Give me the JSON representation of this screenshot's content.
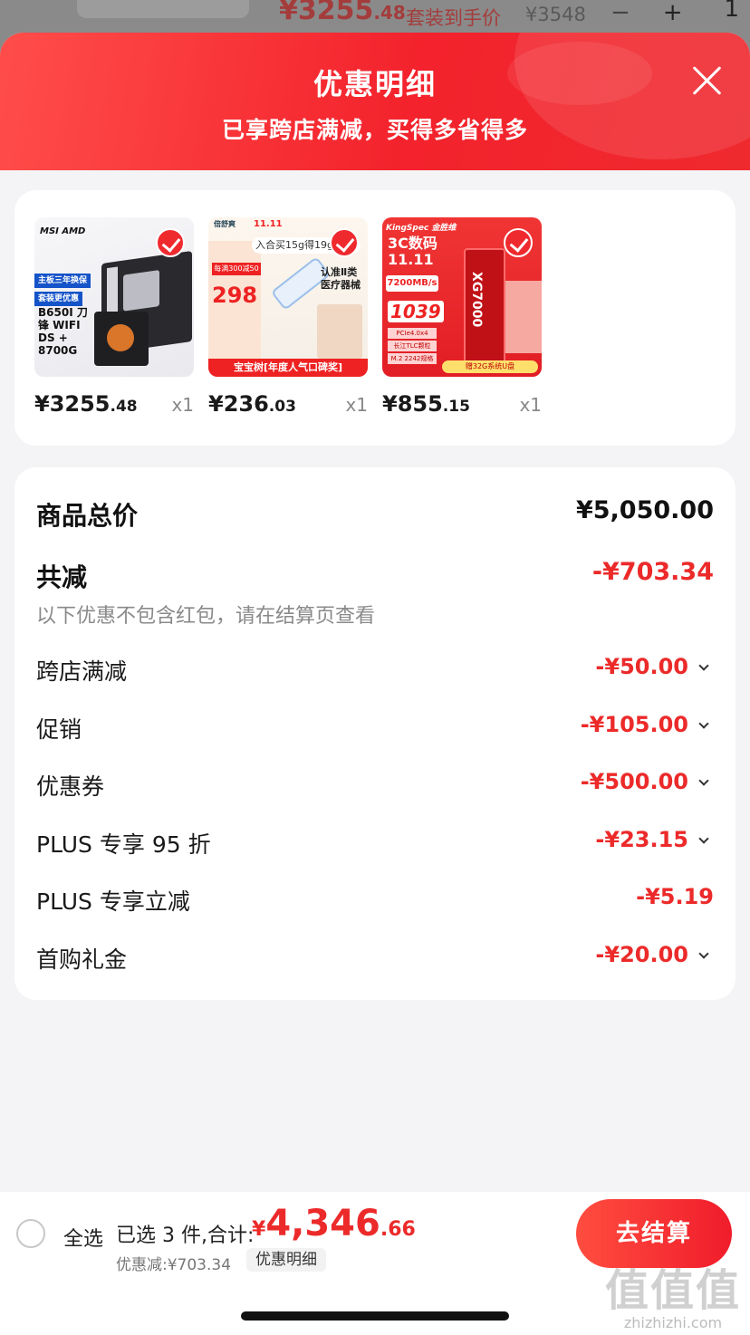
{
  "behind": {
    "price_int": "¥3255",
    "price_dec": ".48",
    "tag": "套装到手价",
    "orig": "¥3548",
    "minus": "−",
    "qty": "1",
    "plus": "+"
  },
  "header": {
    "title": "优惠明细",
    "subtitle": "已享跨店满减，买得多省得多"
  },
  "products": [
    {
      "price_int": "¥3255",
      "price_dec": ".48",
      "qty": "x1",
      "art": {
        "brand": "MSI AMD",
        "tag1": "主板三年换保",
        "tag2": "套装更优惠",
        "model": "B650I 刀锋 WIFI DS + 8700G"
      }
    },
    {
      "price_int": "¥236",
      "price_dec": ".03",
      "qty": "x1",
      "art": {
        "logo": "倍舒爽",
        "date": "11.11",
        "bubble": "入合买15g得19g",
        "label": "每满300减50",
        "big": "298",
        "side": "认准Ⅱ类 医疗器械",
        "bottom": "宝宝树[年度人气口碑奖]"
      }
    },
    {
      "price_int": "¥855",
      "price_dec": ".15",
      "qty": "x1",
      "art": {
        "brand": "KingSpec 金胜维",
        "title": "3C数码 11.11",
        "speed": "7200MB/s",
        "price": "1039",
        "info1": "PCIe4.0x4",
        "info2": "长江TLC颗粒",
        "info3": "M.2 2242规格",
        "ssd": "XG7000",
        "gift": "赠32G系统U盘"
      }
    }
  ],
  "summary": {
    "total_label": "商品总价",
    "total_value": "¥5,050.00",
    "reduce_label": "共减",
    "reduce_value": "-¥703.34",
    "note": "以下优惠不包含红包，请在结算页查看",
    "items": [
      {
        "label": "跨店满减",
        "value": "-¥50.00"
      },
      {
        "label": "促销",
        "value": "-¥105.00"
      },
      {
        "label": "优惠券",
        "value": "-¥500.00"
      },
      {
        "label": "PLUS 专享 95 折",
        "value": "-¥23.15"
      },
      {
        "label": "PLUS 专享立减",
        "value": "-¥5.19"
      },
      {
        "label": "首购礼金",
        "value": "-¥20.00"
      }
    ]
  },
  "footer": {
    "select_all": "全选",
    "selected": "已选 3 件,合计:",
    "total_yen": "¥",
    "total_int": "4,346",
    "total_dec": ".66",
    "saved": "优惠减:¥703.34",
    "detail": "优惠明细",
    "checkout": "去结算"
  },
  "watermark": {
    "big": "值值值",
    "site": "zhizhizhi.com"
  },
  "colors": {
    "accent": "#ec2a2a",
    "header": "#f3222c"
  }
}
